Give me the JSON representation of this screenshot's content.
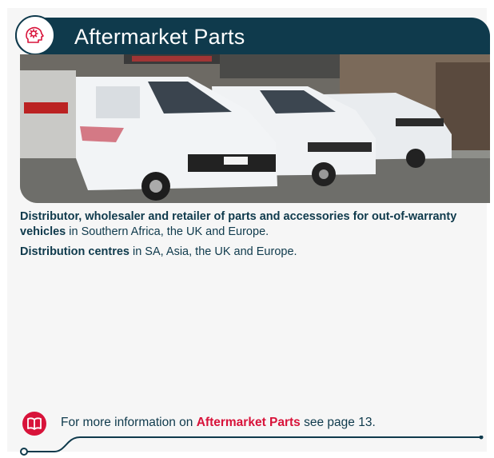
{
  "header": {
    "title": "Aftermarket Parts",
    "icon": "gear-head-icon"
  },
  "photo": {
    "subject": "van-fleet-photo"
  },
  "description": {
    "line1_bold": "Distributor, wholesaler and retailer of parts and accessories for out-of-warranty vehicles",
    "line1_rest": " in Southern Africa, the UK and Europe.",
    "line2_bold": "Distribution centres",
    "line2_rest": " in SA, Asia, the UK and Europe."
  },
  "info": {
    "prefix": "For more information on ",
    "link": "Aftermarket Parts",
    "suffix": " see page 13.",
    "icon": "book-icon"
  },
  "colors": {
    "navy": "#0f3a4c",
    "accent": "#d8133a"
  }
}
